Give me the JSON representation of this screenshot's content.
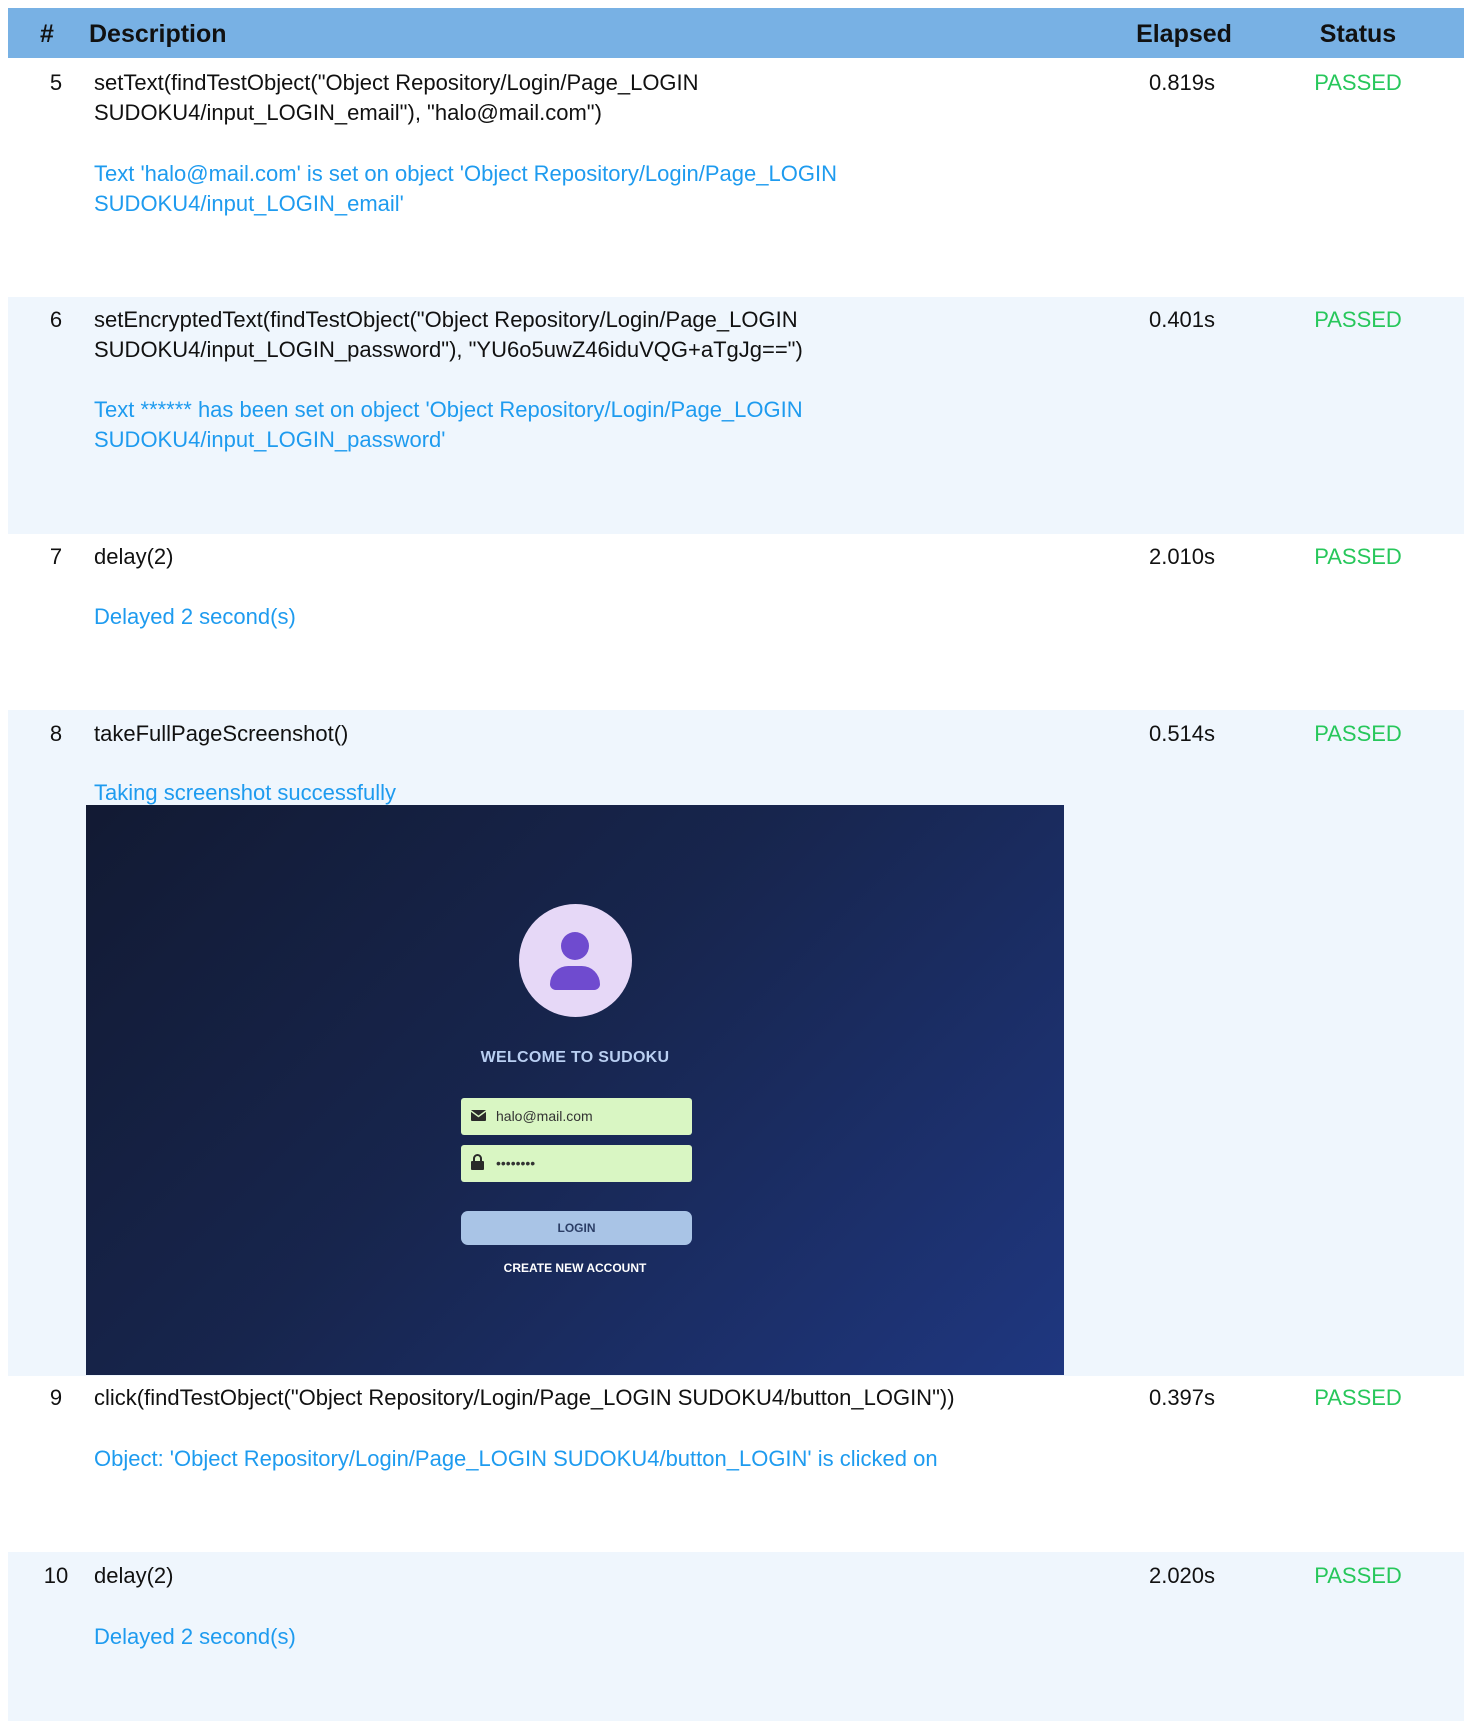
{
  "header": {
    "num": "#",
    "description": "Description",
    "elapsed": "Elapsed",
    "status": "Status"
  },
  "steps": [
    {
      "num": "5",
      "description_lines": [
        "setText(findTestObject(\"Object Repository/Login/Page_LOGIN",
        "SUDOKU4/input_LOGIN_email\"), \"halo@mail.com\")"
      ],
      "message_lines": [
        "Text 'halo@mail.com' is set on object 'Object Repository/Login/Page_LOGIN",
        "SUDOKU4/input_LOGIN_email'"
      ],
      "elapsed": "0.819s",
      "status": "PASSED"
    },
    {
      "num": "6",
      "description_lines": [
        "setEncryptedText(findTestObject(\"Object Repository/Login/Page_LOGIN",
        "SUDOKU4/input_LOGIN_password\"), \"YU6o5uwZ46iduVQG+aTgJg==\")"
      ],
      "message_lines": [
        "Text ****** has been set on object 'Object Repository/Login/Page_LOGIN",
        "SUDOKU4/input_LOGIN_password'"
      ],
      "elapsed": "0.401s",
      "status": "PASSED"
    },
    {
      "num": "7",
      "description_lines": [
        "delay(2)"
      ],
      "message_lines": [
        "Delayed 2 second(s)"
      ],
      "elapsed": "2.010s",
      "status": "PASSED"
    },
    {
      "num": "8",
      "description_lines": [
        "takeFullPageScreenshot()"
      ],
      "message_lines": [
        "Taking screenshot successfully"
      ],
      "elapsed": "0.514s",
      "status": "PASSED"
    },
    {
      "num": "9",
      "description_lines": [
        "click(findTestObject(\"Object Repository/Login/Page_LOGIN SUDOKU4/button_LOGIN\"))"
      ],
      "message_lines": [
        "Object: 'Object Repository/Login/Page_LOGIN SUDOKU4/button_LOGIN' is clicked on"
      ],
      "elapsed": "0.397s",
      "status": "PASSED"
    },
    {
      "num": "10",
      "description_lines": [
        "delay(2)"
      ],
      "message_lines": [
        "Delayed 2 second(s)"
      ],
      "elapsed": "2.020s",
      "status": "PASSED"
    }
  ],
  "screenshot": {
    "welcome": "WELCOME TO SUDOKU",
    "email_value": "halo@mail.com",
    "password_value": "••••••••",
    "login_label": "LOGIN",
    "create_account_label": "CREATE NEW ACCOUNT",
    "icons": [
      "user-icon",
      "envelope-icon",
      "lock-icon"
    ]
  },
  "colors": {
    "header_bg": "#78b1e4",
    "alt_row_bg": "#eff6fd",
    "status_passed": "#27c75b",
    "message": "#1e9bef"
  }
}
